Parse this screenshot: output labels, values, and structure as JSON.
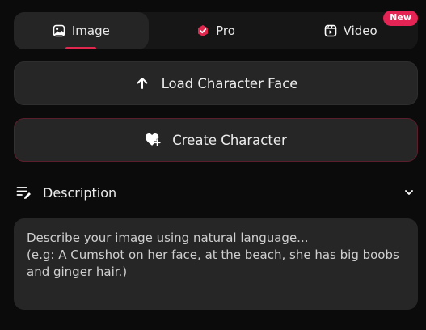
{
  "tabs": [
    {
      "label": "Image",
      "icon": "image-icon",
      "active": true
    },
    {
      "label": "Pro",
      "icon": "pro-badge-icon",
      "active": false
    },
    {
      "label": "Video",
      "icon": "video-icon",
      "active": false,
      "badge": "New"
    }
  ],
  "buttons": {
    "load_face": {
      "label": "Load Character Face",
      "icon": "arrow-up-icon"
    },
    "create_character": {
      "label": "Create Character",
      "icon": "heart-plus-icon"
    }
  },
  "description": {
    "title": "Description",
    "icon": "edit-list-icon",
    "placeholder": "Describe your image using natural language...\n(e.g: A Cumshot on her face, at the beach, she has big boobs and ginger hair.)"
  },
  "colors": {
    "accent": "#e0284f",
    "badge": "#e32454",
    "background": "#0b0b0b",
    "surface": "#262626"
  }
}
